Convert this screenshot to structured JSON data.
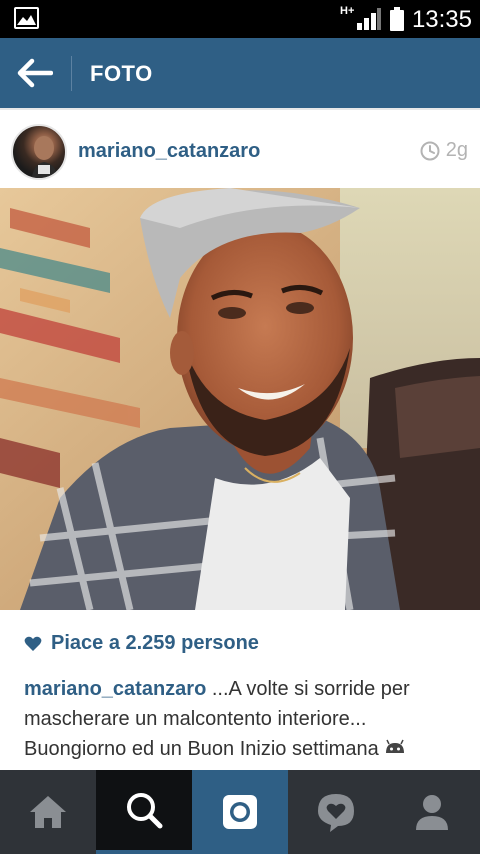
{
  "status_bar": {
    "network_type": "H+",
    "time": "13:35"
  },
  "header": {
    "title": "FOTO"
  },
  "post": {
    "username": "mariano_catanzaro",
    "time_ago": "2g",
    "likes_text": "Piace a 2.259 persone",
    "caption_user": "mariano_catanzaro",
    "caption_text": " ...A volte si sorride per mascherare un malcontento interiore... Buongiorno ed un Buon Inizio settimana"
  },
  "colors": {
    "brand_blue": "#2f5f85",
    "nav_dark": "#2f3338"
  },
  "icons": {
    "back": "arrow-left-icon",
    "time": "clock-icon",
    "likes": "heart-icon",
    "nav": [
      "home-icon",
      "search-icon",
      "camera-icon",
      "activity-heart-icon",
      "profile-icon"
    ]
  }
}
